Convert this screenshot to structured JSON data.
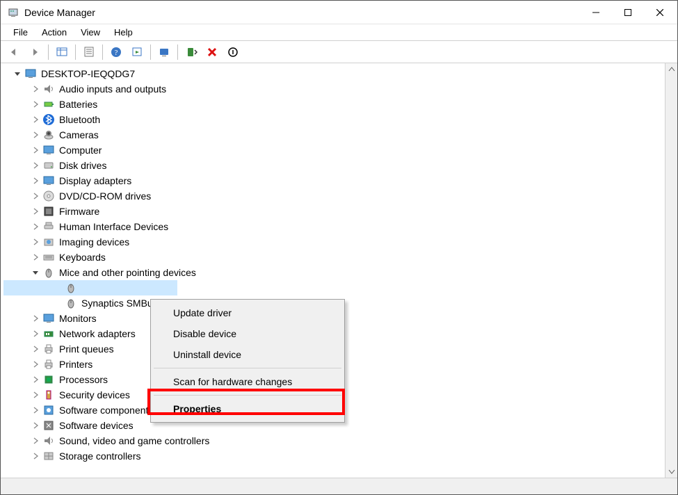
{
  "window": {
    "title": "Device Manager"
  },
  "menu": {
    "file": "File",
    "action": "Action",
    "view": "View",
    "help": "Help"
  },
  "root": {
    "name": "DESKTOP-IEQQDG7"
  },
  "categories": [
    {
      "label": "Audio inputs and outputs",
      "iconKey": "audio"
    },
    {
      "label": "Batteries",
      "iconKey": "battery"
    },
    {
      "label": "Bluetooth",
      "iconKey": "bluetooth"
    },
    {
      "label": "Cameras",
      "iconKey": "camera"
    },
    {
      "label": "Computer",
      "iconKey": "computer"
    },
    {
      "label": "Disk drives",
      "iconKey": "disk"
    },
    {
      "label": "Display adapters",
      "iconKey": "display"
    },
    {
      "label": "DVD/CD-ROM drives",
      "iconKey": "dvd"
    },
    {
      "label": "Firmware",
      "iconKey": "firmware"
    },
    {
      "label": "Human Interface Devices",
      "iconKey": "hid"
    },
    {
      "label": "Imaging devices",
      "iconKey": "imaging"
    },
    {
      "label": "Keyboards",
      "iconKey": "keyboard"
    },
    {
      "label": "Mice and other pointing devices",
      "iconKey": "mouse",
      "expanded": true,
      "children": [
        {
          "label": "",
          "iconKey": "mouse",
          "selected": true
        },
        {
          "label": "Synaptics SMBu",
          "iconKey": "mouse"
        }
      ]
    },
    {
      "label": "Monitors",
      "iconKey": "monitor"
    },
    {
      "label": "Network adapters",
      "iconKey": "network"
    },
    {
      "label": "Print queues",
      "iconKey": "printer"
    },
    {
      "label": "Printers",
      "iconKey": "printer"
    },
    {
      "label": "Processors",
      "iconKey": "cpu"
    },
    {
      "label": "Security devices",
      "iconKey": "security"
    },
    {
      "label": "Software components",
      "iconKey": "swcomp"
    },
    {
      "label": "Software devices",
      "iconKey": "swdev"
    },
    {
      "label": "Sound, video and game controllers",
      "iconKey": "sound"
    },
    {
      "label": "Storage controllers",
      "iconKey": "storage"
    }
  ],
  "contextMenu": {
    "update": "Update driver",
    "disable": "Disable device",
    "uninstall": "Uninstall device",
    "scan": "Scan for hardware changes",
    "properties": "Properties"
  }
}
